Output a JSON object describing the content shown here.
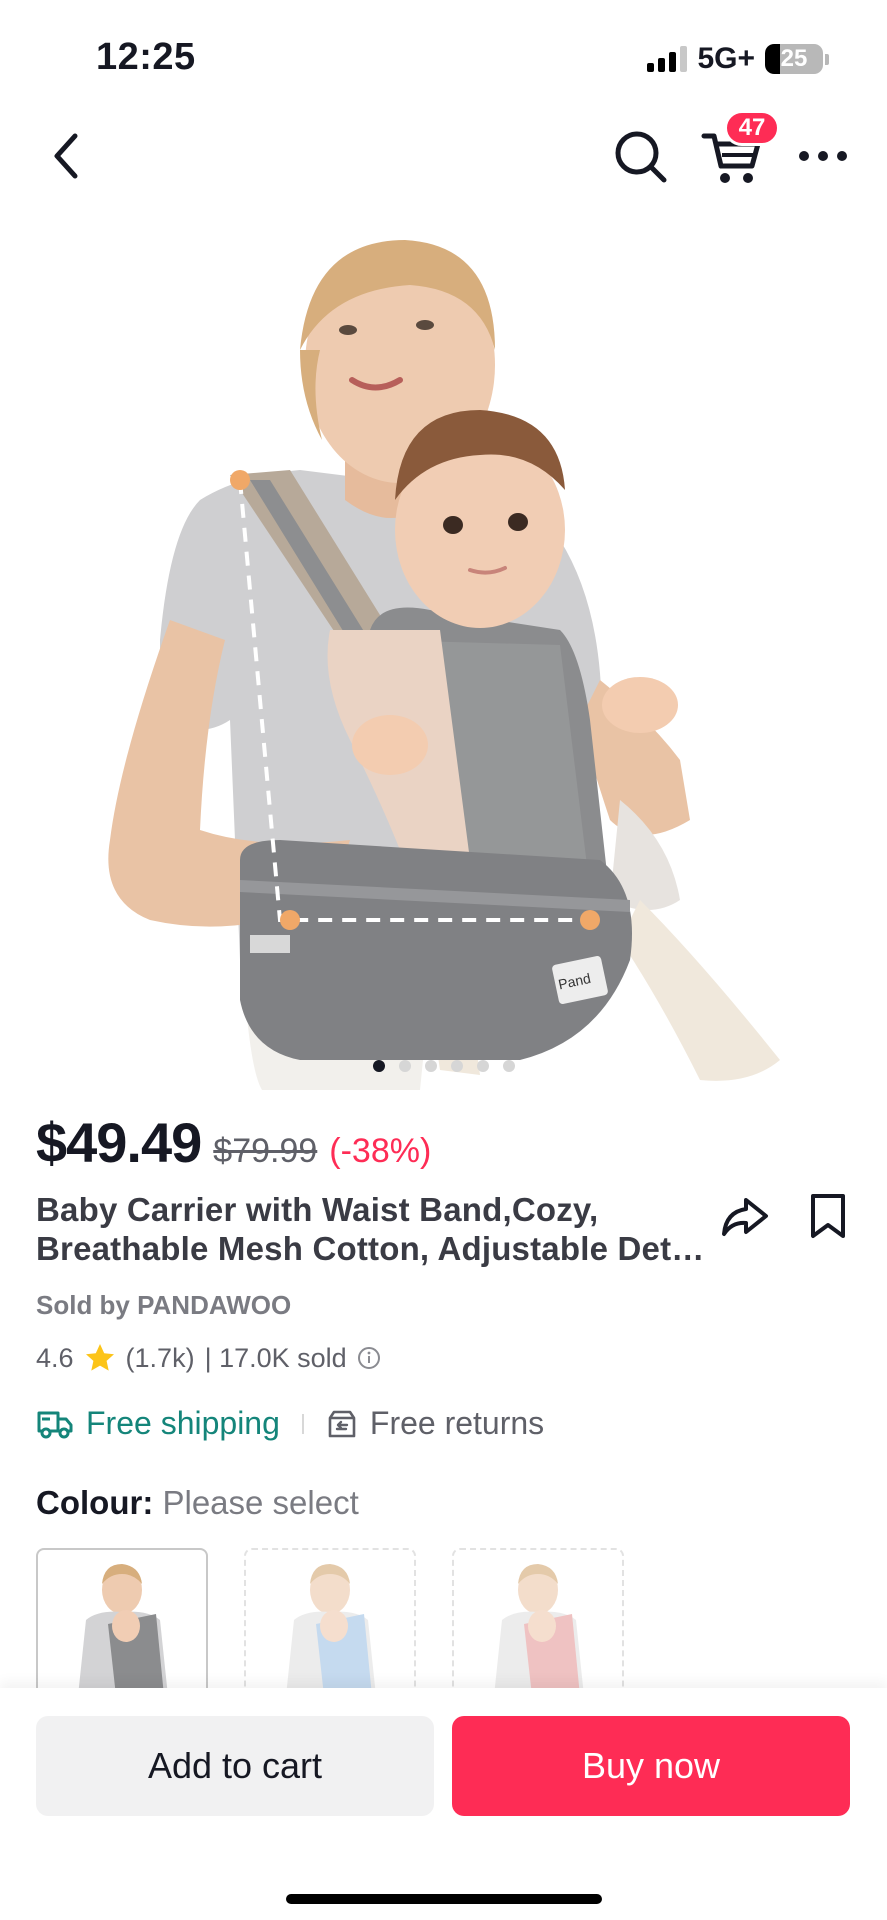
{
  "status_bar": {
    "time": "12:25",
    "network": "5G+",
    "battery": "25",
    "battery_level": 0.25
  },
  "nav": {
    "back_icon": "chevron-left-icon",
    "search_icon": "search-icon",
    "cart_icon": "cart-icon",
    "cart_count": "47",
    "more_icon": "more-horizontal-icon"
  },
  "gallery": {
    "image_count": 6,
    "active_index": 0,
    "logo_text": "Pand"
  },
  "product": {
    "price": "$49.49",
    "original_price": "$79.99",
    "discount": "(-38%)",
    "title": "Baby Carrier with Waist Band,Cozy, Breathable Mesh Cotton, Adjustable Det…",
    "seller": "Sold by PANDAWOO",
    "rating": "4.6",
    "reviews": "(1.7k)",
    "sold": "| 17.0K sold"
  },
  "shipping": {
    "free_shipping": "Free shipping",
    "free_returns": "Free returns"
  },
  "colour": {
    "label": "Colour:",
    "value": "Please select"
  },
  "actions": {
    "add_to_cart": "Add to cart",
    "buy_now": "Buy now"
  },
  "colors": {
    "accent": "#fe2c55",
    "shipping": "#14857a",
    "star": "#fcc419"
  }
}
